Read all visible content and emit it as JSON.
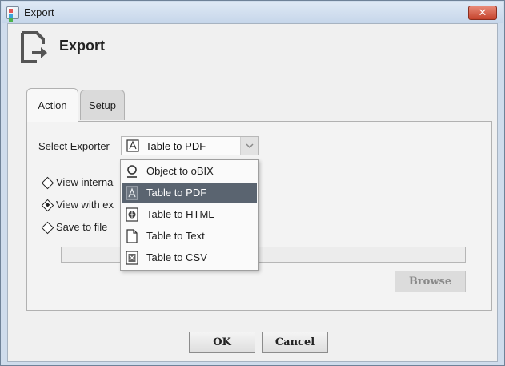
{
  "window": {
    "title": "Export",
    "close_glyph": "✕",
    "accent_color": "#c5432c"
  },
  "header": {
    "title": "Export",
    "icon": "export-document-icon"
  },
  "tabs": [
    {
      "label": "Action",
      "active": true
    },
    {
      "label": "Setup",
      "active": false
    }
  ],
  "form": {
    "select_exporter_label": "Select Exporter",
    "selected_exporter": "Table to PDF",
    "options": [
      {
        "label": "View internally",
        "visible_text": "View interna",
        "checked": false
      },
      {
        "label": "View with external application",
        "visible_text": "View with ex",
        "checked": true
      },
      {
        "label": "Save to file",
        "visible_text": "Save to file",
        "checked": false
      }
    ],
    "file_path_value": "",
    "browse_label": "Browse"
  },
  "dropdown": {
    "items": [
      {
        "label": "Object to oBIX",
        "icon": "obix-object-icon",
        "selected": false
      },
      {
        "label": "Table to PDF",
        "icon": "pdf-icon",
        "selected": true
      },
      {
        "label": "Table to HTML",
        "icon": "html-icon",
        "selected": false
      },
      {
        "label": "Table to Text",
        "icon": "text-document-icon",
        "selected": false
      },
      {
        "label": "Table to CSV",
        "icon": "csv-icon",
        "selected": false
      }
    ]
  },
  "footer": {
    "ok_label": "OK",
    "cancel_label": "Cancel"
  }
}
